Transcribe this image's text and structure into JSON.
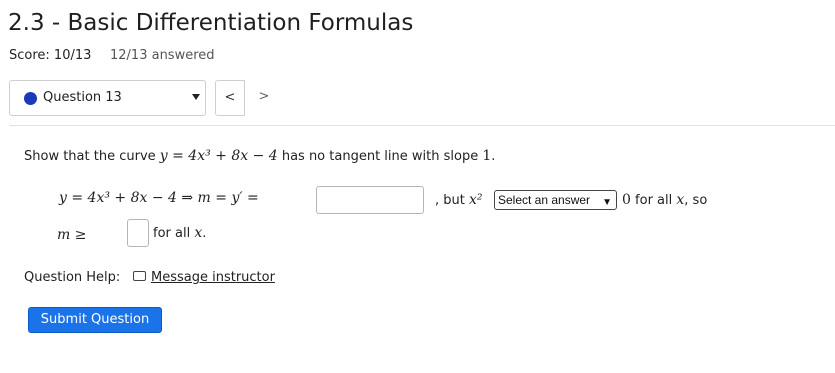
{
  "header": {
    "title": "2.3 - Basic Differentiation Formulas",
    "score": "Score: 10/13",
    "answered": "12/13 answered"
  },
  "question_nav": {
    "current": "Question 13",
    "prev_symbol": "<",
    "next_symbol": ">"
  },
  "question": {
    "prompt_before": "Show that the curve ",
    "prompt_math": "y = 4x³ + 8x − 4",
    "prompt_after": " has no tangent line with slope ",
    "prompt_math2": "1",
    "prompt_end": ".",
    "line1_math": "y = 4x³ + 8x − 4 ⇒ m = y′ =",
    "input1_value": "",
    "but_text": ", but ",
    "but_math": "x²",
    "select_value": "Select an answer",
    "after_select_math": "0",
    "after_select_text": " for all ",
    "after_select_var": "x",
    "after_select_end": ", so",
    "line2_math": "m ≥",
    "input2_value": "",
    "line2_text": "for all ",
    "line2_var": "x",
    "line2_end": "."
  },
  "help": {
    "label": "Question Help:",
    "link_text": "Message instructor"
  },
  "submit_label": "Submit Question",
  "colors": {
    "accent": "#1a73e8",
    "dot": "#1a3ab8"
  },
  "icons": {
    "mail": "mail-icon",
    "caret": "caret-down-icon"
  }
}
